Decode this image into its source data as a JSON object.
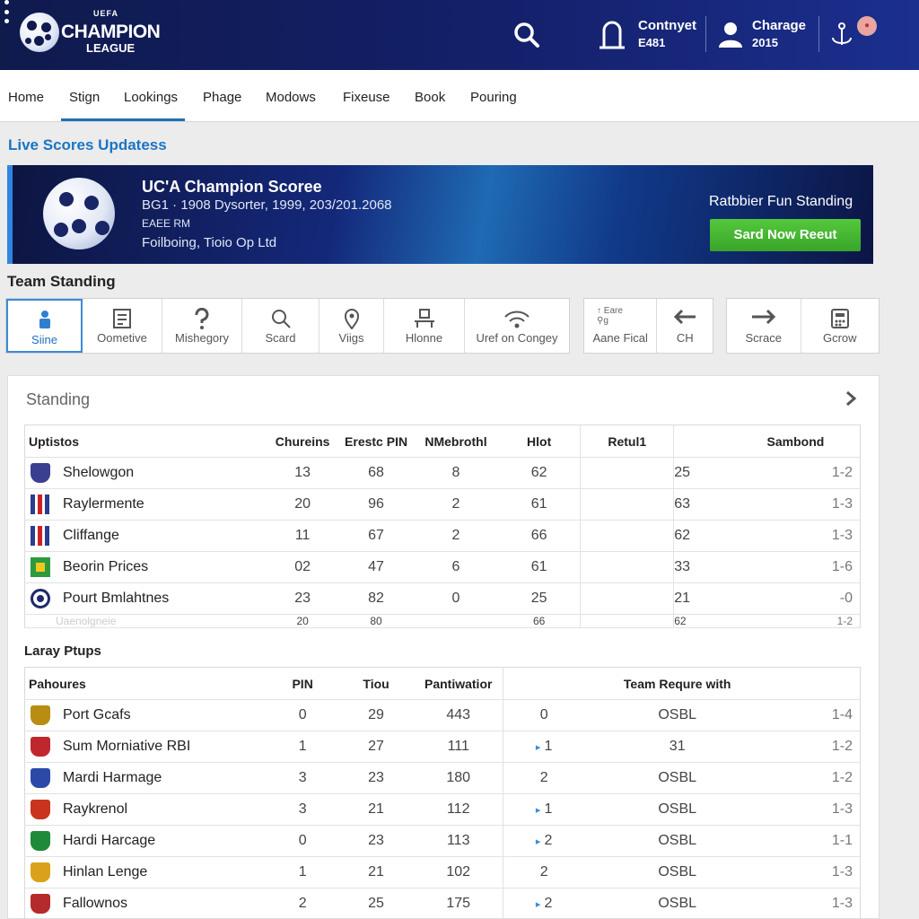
{
  "header": {
    "logo_top": "UEFA",
    "logo_title": "CHAMPION",
    "logo_sub": "LEAGUE",
    "contact_line1": "Contnyet",
    "contact_line2": "E481",
    "user_line1": "Charage",
    "user_line2": "2015",
    "notif_badge": "●"
  },
  "nav": {
    "items": [
      "Home",
      "Stign",
      "Lookings",
      "Phage",
      "Modows",
      "Fixeuse",
      "Book",
      "Pouring"
    ],
    "active": "Lookings"
  },
  "live_title": "Live Scores Updatess",
  "banner": {
    "title": "UC'A Champion Scoree",
    "line2": "BG1 · 1908 Dysorter, 1999, 203/201.2068",
    "line3": "EAEE RM",
    "line4": "Foilboing, Tioio Op Ltd",
    "right_text": "Ratbbier Fun Standing",
    "button": "Sard Now Reeut"
  },
  "team_standing_title": "Team Standing",
  "tabs_group1": [
    {
      "label": "Siine",
      "icon": "person-icon",
      "active": true
    },
    {
      "label": "Oometive",
      "icon": "document-icon"
    },
    {
      "label": "Mishegory",
      "icon": "question-icon"
    },
    {
      "label": "Scard",
      "icon": "search-icon"
    },
    {
      "label": "Viigs",
      "icon": "location-pin-icon"
    },
    {
      "label": "Hlonne",
      "icon": "desk-icon"
    },
    {
      "label": "Uref on Congey",
      "icon": "wifi-icon"
    }
  ],
  "tabs_group2": [
    {
      "label": "Aane Fical",
      "top": "↑ Eare\n⚲g"
    },
    {
      "label": "CH",
      "icon": "arrow-left-icon"
    }
  ],
  "tabs_group3": [
    {
      "label": "Scrace",
      "icon": "arrow-right-icon"
    },
    {
      "label": "Gcrow",
      "icon": "calculator-icon"
    }
  ],
  "panel": {
    "title": "Standing",
    "table1": {
      "headers": [
        "Uptistos",
        "Chureins",
        "Erestc PIN",
        "NMebrothl",
        "Hlot",
        "Retul1",
        "",
        "Sambond"
      ],
      "rows": [
        {
          "team": "Shelowgon",
          "crest": "#3a3f8f",
          "c1": "13",
          "c2": "68",
          "c3": "8",
          "c4": "62",
          "c5": "25",
          "c6": "1-2"
        },
        {
          "team": "Raylermente",
          "crest": "stripes-blue-red",
          "c1": "20",
          "c2": "96",
          "c3": "2",
          "c4": "61",
          "c5": "63",
          "c6": "1-3"
        },
        {
          "team": "Cliffange",
          "crest": "stripes-blue-red",
          "c1": "11",
          "c2": "67",
          "c3": "2",
          "c4": "66",
          "c5": "62",
          "c6": "1-3"
        },
        {
          "team": "Beorin Prices",
          "crest": "#2d9a3e",
          "c1": "02",
          "c2": "47",
          "c3": "6",
          "c4": "61",
          "c5": "33",
          "c6": "1-6"
        },
        {
          "team": "Pourt Bmlahtnes",
          "crest": "#1d2a6b",
          "c1": "23",
          "c2": "82",
          "c3": "0",
          "c4": "25",
          "c5": "21",
          "c6": "-0"
        }
      ],
      "fade_row": {
        "team": "Uaenolgneie",
        "c1": "20",
        "c2": "80",
        "c3": "",
        "c4": "66",
        "c5": "62",
        "c6": "1-2"
      }
    },
    "table2_title": "Laray Ptups",
    "table2": {
      "headers": [
        "Pahoures",
        "PIN",
        "Tiou",
        "Pantiwatior",
        "",
        "Team Requre with",
        ""
      ],
      "rows": [
        {
          "team": "Port Gcafs",
          "crest": "#b98d12",
          "c1": "0",
          "c2": "29",
          "c3": "443",
          "arrow": false,
          "c4": "0",
          "c5": "OSBL",
          "c6": "1-4"
        },
        {
          "team": "Sum Morniative RBI",
          "crest": "#c0272d",
          "c1": "1",
          "c2": "27",
          "c3": "111",
          "arrow": true,
          "c4": "1",
          "c5": "31",
          "c6": "1-2"
        },
        {
          "team": "Mardi Harmage",
          "crest": "#2b4aa8",
          "c1": "3",
          "c2": "23",
          "c3": "180",
          "arrow": false,
          "c4": "2",
          "c5": "OSBL",
          "c6": "1-2"
        },
        {
          "team": "Raykrenol",
          "crest": "#c8341e",
          "c1": "3",
          "c2": "21",
          "c3": "112",
          "arrow": true,
          "c4": "1",
          "c5": "OSBL",
          "c6": "1-3"
        },
        {
          "team": "Hardi Harcage",
          "crest": "#1f8a3a",
          "c1": "0",
          "c2": "23",
          "c3": "113",
          "arrow": true,
          "c4": "2",
          "c5": "OSBL",
          "c6": "1-1"
        },
        {
          "team": "Hinlan Lenge",
          "crest": "#d9a21a",
          "c1": "1",
          "c2": "21",
          "c3": "102",
          "arrow": false,
          "c4": "2",
          "c5": "OSBL",
          "c6": "1-3"
        },
        {
          "team": "Fallownos",
          "crest": "#b52a2a",
          "c1": "2",
          "c2": "25",
          "c3": "175",
          "arrow": true,
          "c4": "2",
          "c5": "OSBL",
          "c6": "1-3"
        }
      ]
    }
  }
}
